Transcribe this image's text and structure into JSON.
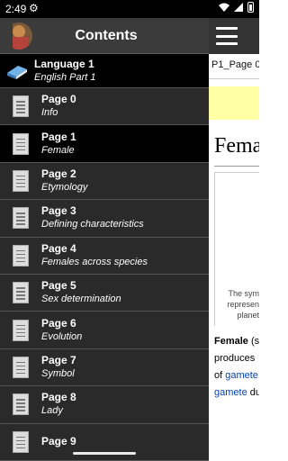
{
  "status": {
    "time": "2:49"
  },
  "drawer": {
    "title": "Contents",
    "language": {
      "title": "Language 1",
      "subtitle": "English Part 1"
    },
    "pages": [
      {
        "title": "Page 0",
        "subtitle": "Info"
      },
      {
        "title": "Page 1",
        "subtitle": "Female"
      },
      {
        "title": "Page 2",
        "subtitle": "Etymology"
      },
      {
        "title": "Page 3",
        "subtitle": "Defining characteristics"
      },
      {
        "title": "Page 4",
        "subtitle": "Females across species"
      },
      {
        "title": "Page 5",
        "subtitle": "Sex determination"
      },
      {
        "title": "Page 6",
        "subtitle": "Evolution"
      },
      {
        "title": "Page 7",
        "subtitle": "Symbol"
      },
      {
        "title": "Page 8",
        "subtitle": "Lady"
      },
      {
        "title": "Page 9",
        "subtitle": ""
      }
    ],
    "active_index": 1
  },
  "content": {
    "page_label": "P1_Page 0",
    "heading": "Femal",
    "caption": [
      "The sym",
      "represen",
      "planet"
    ],
    "paragraph": {
      "line1_bold": "Female",
      "line1_rest": " (s",
      "line2": "produces",
      "line3_pre": "of ",
      "line3_link": "gamete",
      "line4_link": "gamete",
      "line4_rest": " du"
    }
  },
  "colors": {
    "drawer_bg": "#262626",
    "header_bg": "#3b3b3b",
    "active_row": "#000000",
    "banner": "#ffffa6",
    "link": "#0645ad"
  }
}
